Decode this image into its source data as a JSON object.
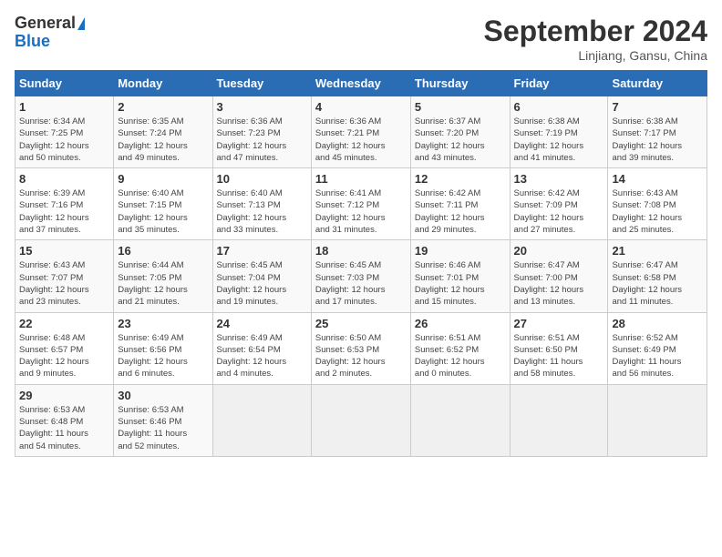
{
  "header": {
    "logo_general": "General",
    "logo_blue": "Blue",
    "month_title": "September 2024",
    "location": "Linjiang, Gansu, China"
  },
  "days_of_week": [
    "Sunday",
    "Monday",
    "Tuesday",
    "Wednesday",
    "Thursday",
    "Friday",
    "Saturday"
  ],
  "weeks": [
    [
      {
        "day": "1",
        "detail": "Sunrise: 6:34 AM\nSunset: 7:25 PM\nDaylight: 12 hours\nand 50 minutes."
      },
      {
        "day": "2",
        "detail": "Sunrise: 6:35 AM\nSunset: 7:24 PM\nDaylight: 12 hours\nand 49 minutes."
      },
      {
        "day": "3",
        "detail": "Sunrise: 6:36 AM\nSunset: 7:23 PM\nDaylight: 12 hours\nand 47 minutes."
      },
      {
        "day": "4",
        "detail": "Sunrise: 6:36 AM\nSunset: 7:21 PM\nDaylight: 12 hours\nand 45 minutes."
      },
      {
        "day": "5",
        "detail": "Sunrise: 6:37 AM\nSunset: 7:20 PM\nDaylight: 12 hours\nand 43 minutes."
      },
      {
        "day": "6",
        "detail": "Sunrise: 6:38 AM\nSunset: 7:19 PM\nDaylight: 12 hours\nand 41 minutes."
      },
      {
        "day": "7",
        "detail": "Sunrise: 6:38 AM\nSunset: 7:17 PM\nDaylight: 12 hours\nand 39 minutes."
      }
    ],
    [
      {
        "day": "8",
        "detail": "Sunrise: 6:39 AM\nSunset: 7:16 PM\nDaylight: 12 hours\nand 37 minutes."
      },
      {
        "day": "9",
        "detail": "Sunrise: 6:40 AM\nSunset: 7:15 PM\nDaylight: 12 hours\nand 35 minutes."
      },
      {
        "day": "10",
        "detail": "Sunrise: 6:40 AM\nSunset: 7:13 PM\nDaylight: 12 hours\nand 33 minutes."
      },
      {
        "day": "11",
        "detail": "Sunrise: 6:41 AM\nSunset: 7:12 PM\nDaylight: 12 hours\nand 31 minutes."
      },
      {
        "day": "12",
        "detail": "Sunrise: 6:42 AM\nSunset: 7:11 PM\nDaylight: 12 hours\nand 29 minutes."
      },
      {
        "day": "13",
        "detail": "Sunrise: 6:42 AM\nSunset: 7:09 PM\nDaylight: 12 hours\nand 27 minutes."
      },
      {
        "day": "14",
        "detail": "Sunrise: 6:43 AM\nSunset: 7:08 PM\nDaylight: 12 hours\nand 25 minutes."
      }
    ],
    [
      {
        "day": "15",
        "detail": "Sunrise: 6:43 AM\nSunset: 7:07 PM\nDaylight: 12 hours\nand 23 minutes."
      },
      {
        "day": "16",
        "detail": "Sunrise: 6:44 AM\nSunset: 7:05 PM\nDaylight: 12 hours\nand 21 minutes."
      },
      {
        "day": "17",
        "detail": "Sunrise: 6:45 AM\nSunset: 7:04 PM\nDaylight: 12 hours\nand 19 minutes."
      },
      {
        "day": "18",
        "detail": "Sunrise: 6:45 AM\nSunset: 7:03 PM\nDaylight: 12 hours\nand 17 minutes."
      },
      {
        "day": "19",
        "detail": "Sunrise: 6:46 AM\nSunset: 7:01 PM\nDaylight: 12 hours\nand 15 minutes."
      },
      {
        "day": "20",
        "detail": "Sunrise: 6:47 AM\nSunset: 7:00 PM\nDaylight: 12 hours\nand 13 minutes."
      },
      {
        "day": "21",
        "detail": "Sunrise: 6:47 AM\nSunset: 6:58 PM\nDaylight: 12 hours\nand 11 minutes."
      }
    ],
    [
      {
        "day": "22",
        "detail": "Sunrise: 6:48 AM\nSunset: 6:57 PM\nDaylight: 12 hours\nand 9 minutes."
      },
      {
        "day": "23",
        "detail": "Sunrise: 6:49 AM\nSunset: 6:56 PM\nDaylight: 12 hours\nand 6 minutes."
      },
      {
        "day": "24",
        "detail": "Sunrise: 6:49 AM\nSunset: 6:54 PM\nDaylight: 12 hours\nand 4 minutes."
      },
      {
        "day": "25",
        "detail": "Sunrise: 6:50 AM\nSunset: 6:53 PM\nDaylight: 12 hours\nand 2 minutes."
      },
      {
        "day": "26",
        "detail": "Sunrise: 6:51 AM\nSunset: 6:52 PM\nDaylight: 12 hours\nand 0 minutes."
      },
      {
        "day": "27",
        "detail": "Sunrise: 6:51 AM\nSunset: 6:50 PM\nDaylight: 11 hours\nand 58 minutes."
      },
      {
        "day": "28",
        "detail": "Sunrise: 6:52 AM\nSunset: 6:49 PM\nDaylight: 11 hours\nand 56 minutes."
      }
    ],
    [
      {
        "day": "29",
        "detail": "Sunrise: 6:53 AM\nSunset: 6:48 PM\nDaylight: 11 hours\nand 54 minutes."
      },
      {
        "day": "30",
        "detail": "Sunrise: 6:53 AM\nSunset: 6:46 PM\nDaylight: 11 hours\nand 52 minutes."
      },
      {
        "day": "",
        "detail": ""
      },
      {
        "day": "",
        "detail": ""
      },
      {
        "day": "",
        "detail": ""
      },
      {
        "day": "",
        "detail": ""
      },
      {
        "day": "",
        "detail": ""
      }
    ]
  ]
}
